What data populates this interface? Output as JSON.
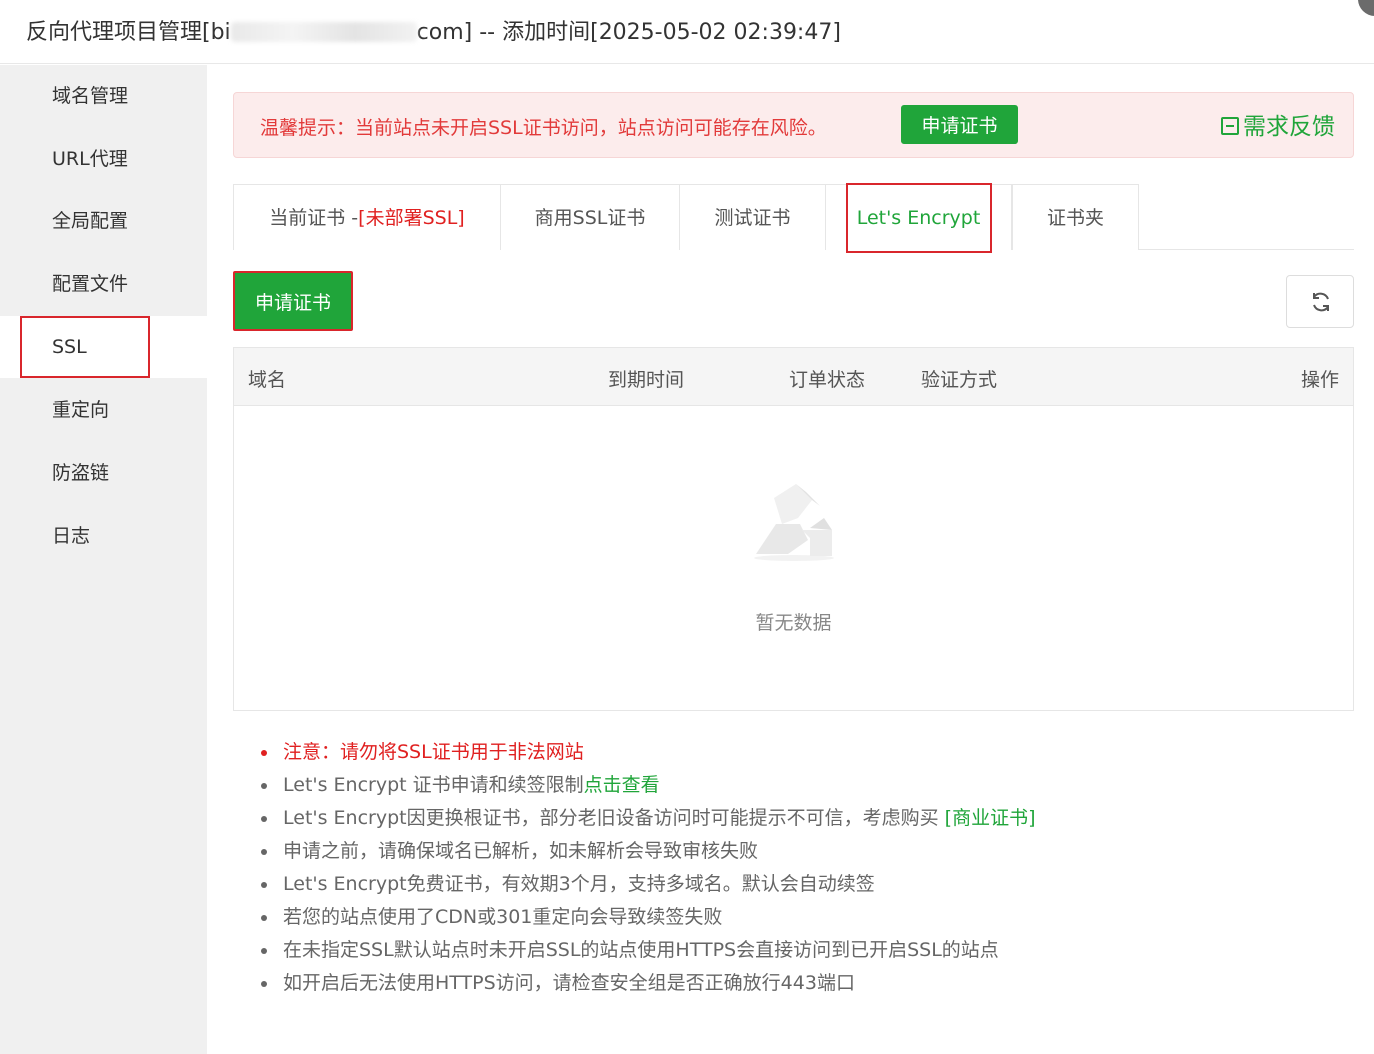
{
  "window": {
    "title_prefix": "反向代理项目管理[bi",
    "title_suffix": "com] -- 添加时间[2025-05-02 02:39:47]"
  },
  "sidebar": {
    "items": [
      {
        "label": "域名管理"
      },
      {
        "label": "URL代理"
      },
      {
        "label": "全局配置"
      },
      {
        "label": "配置文件"
      },
      {
        "label": "SSL"
      },
      {
        "label": "重定向"
      },
      {
        "label": "防盗链"
      },
      {
        "label": "日志"
      }
    ],
    "active_index": 4
  },
  "alert": {
    "text": "温馨提示：当前站点未开启SSL证书访问，站点访问可能存在风险。",
    "button": "申请证书",
    "feedback": "需求反馈"
  },
  "tabs": [
    {
      "label": "当前证书 -",
      "extra": "[未部署SSL]"
    },
    {
      "label": "商用SSL证书"
    },
    {
      "label": "测试证书"
    },
    {
      "label": "Let's Encrypt"
    },
    {
      "label": "证书夹"
    }
  ],
  "toolbar": {
    "apply_button": "申请证书"
  },
  "table": {
    "columns": [
      "域名",
      "到期时间",
      "订单状态",
      "验证方式",
      "操作"
    ],
    "rows": [],
    "empty_text": "暂无数据"
  },
  "notes": {
    "n1": "注意：请勿将SSL证书用于非法网站",
    "n2_text": "Let's Encrypt 证书申请和续签限制",
    "n2_link": "点击查看",
    "n3_text": "Let's Encrypt因更换根证书，部分老旧设备访问时可能提示不可信，考虑购买 ",
    "n3_link": "[商业证书]",
    "n4": "申请之前，请确保域名已解析，如未解析会导致审核失败",
    "n5": "Let's Encrypt免费证书，有效期3个月，支持多域名。默认会自动续签",
    "n6": "若您的站点使用了CDN或301重定向会导致续签失败",
    "n7": "在未指定SSL默认站点时未开启SSL的站点使用HTTPS会直接访问到已开启SSL的站点",
    "n8": "如开启后无法使用HTTPS访问，请检查安全组是否正确放行443端口"
  },
  "colors": {
    "accent_green": "#20a53a",
    "warn_red": "#e02020",
    "highlight_red": "#d9262c"
  }
}
